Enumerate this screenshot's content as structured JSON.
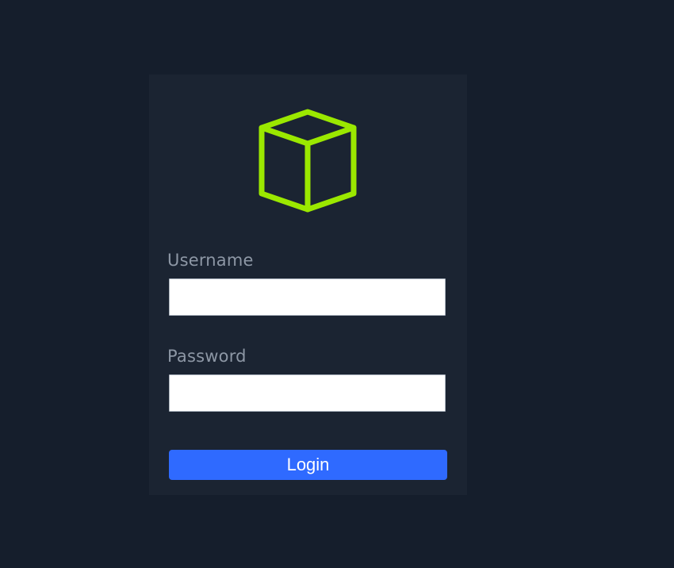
{
  "login_form": {
    "logo_icon": "cube-icon",
    "accent_color": "#9be800",
    "username_label": "Username",
    "username_value": "",
    "password_label": "Password",
    "password_value": "",
    "login_button_label": "Login",
    "button_color": "#2f6aff"
  }
}
